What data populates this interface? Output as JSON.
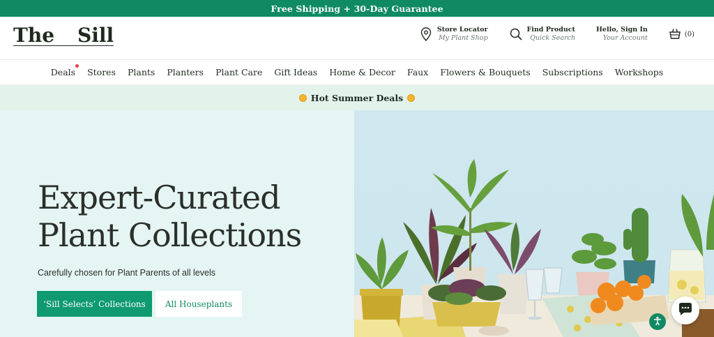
{
  "topbar": {
    "text": "Free Shipping + 30-Day Guarantee"
  },
  "logo": {
    "word1": "The",
    "word2": "Sill"
  },
  "header": {
    "store_locator": {
      "title": "Store Locator",
      "subtitle": "My Plant Shop",
      "icon": "map-pin-icon"
    },
    "find_product": {
      "title": "Find Product",
      "subtitle": "Quick Search",
      "icon": "search-icon"
    },
    "account": {
      "title": "Hello, Sign In",
      "subtitle": "Your Account"
    },
    "cart": {
      "count": "(0)",
      "icon": "basket-icon"
    }
  },
  "nav": {
    "items": [
      {
        "label": "Deals"
      },
      {
        "label": "Stores"
      },
      {
        "label": "Plants"
      },
      {
        "label": "Planters"
      },
      {
        "label": "Plant Care"
      },
      {
        "label": "Gift Ideas"
      },
      {
        "label": "Home & Decor"
      },
      {
        "label": "Faux"
      },
      {
        "label": "Flowers & Bouquets"
      },
      {
        "label": "Subscriptions"
      },
      {
        "label": "Workshops"
      }
    ]
  },
  "promo": {
    "text": "Hot Summer Deals"
  },
  "hero": {
    "title_line1": "Expert-Curated",
    "title_line2": "Plant Collections",
    "subtitle": "Carefully chosen for Plant Parents of all levels",
    "primary_button": "‘Sill Selects’ Collections",
    "secondary_button": "All Houseplants"
  },
  "colors": {
    "brand_green": "#0f8a63",
    "hero_bg": "#e4f5f3",
    "promo_bg": "#e3f3ec",
    "deal_dot": "#e2454c"
  }
}
